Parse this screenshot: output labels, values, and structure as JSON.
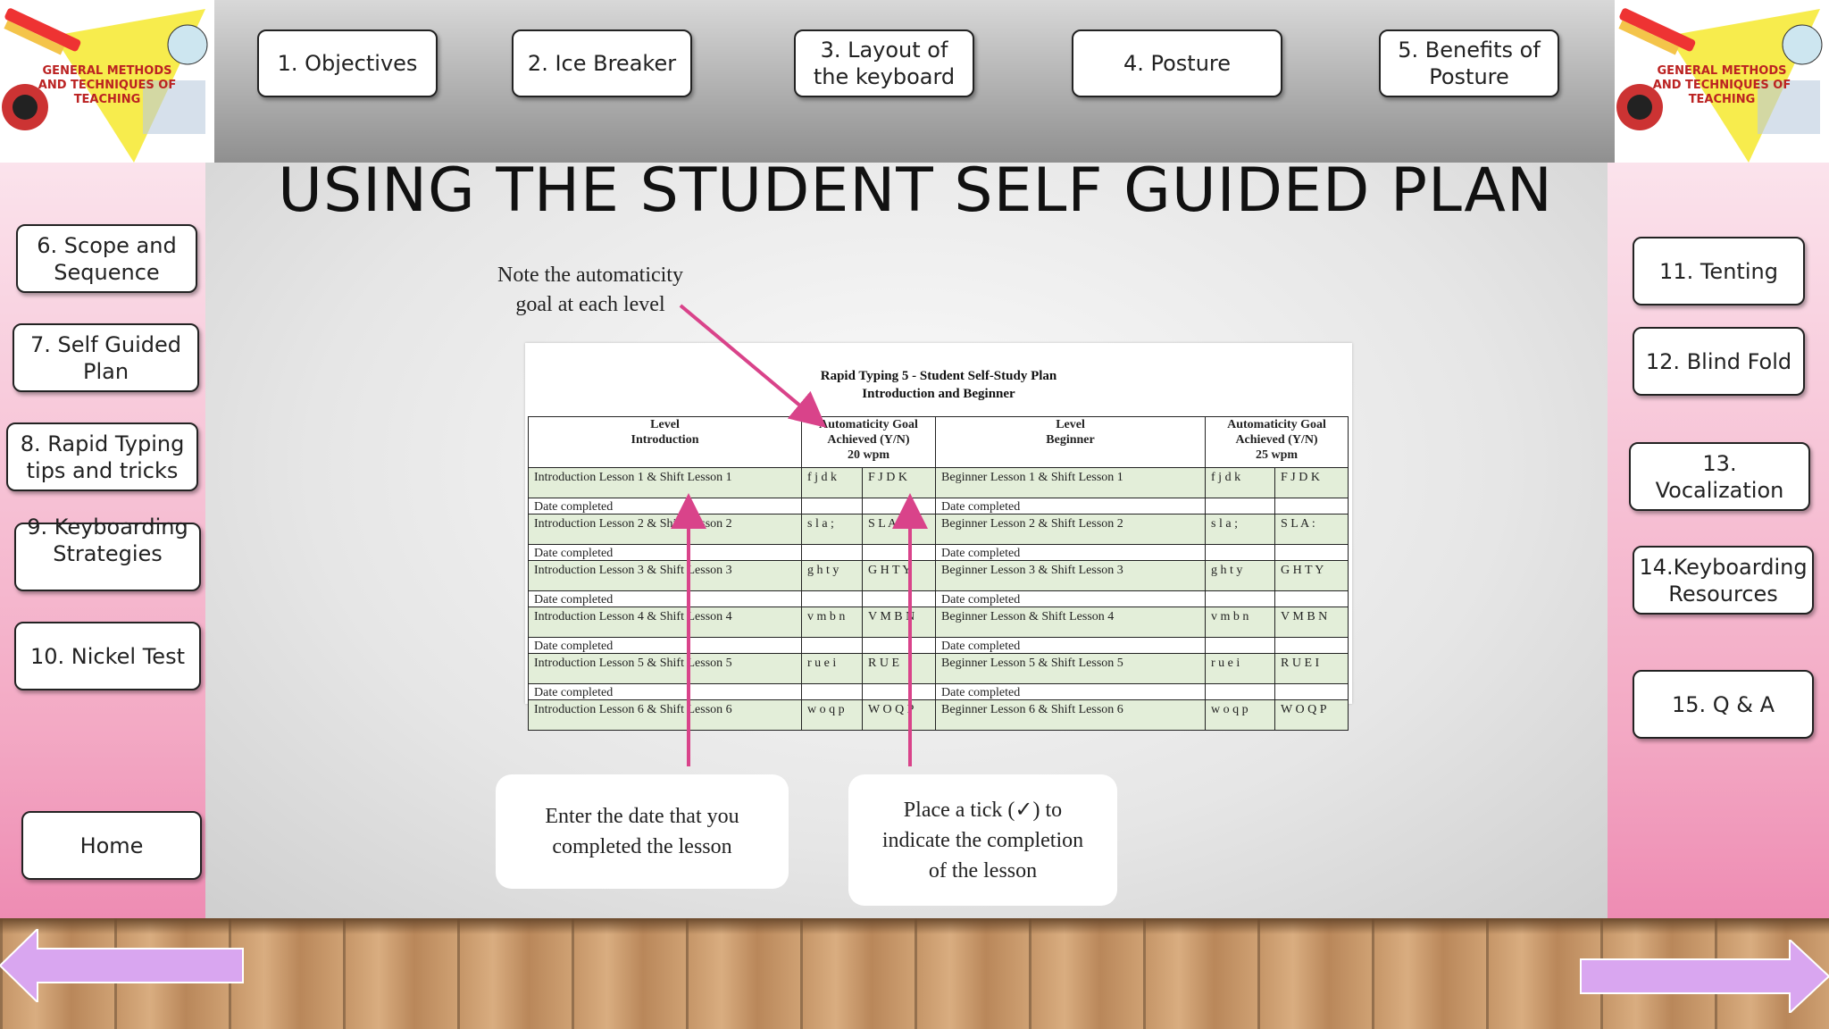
{
  "logo": {
    "text": "GENERAL METHODS AND TECHNIQUES OF TEACHING"
  },
  "top_nav": [
    "1. Objectives",
    "2. Ice Breaker",
    "3. Layout of the keyboard",
    "4. Posture",
    "5. Benefits of Posture"
  ],
  "left_nav": [
    "6. Scope and Sequence",
    "7. Self Guided Plan",
    "8. Rapid Typing tips and tricks",
    "9. Keyboarding Strategies",
    "10. Nickel Test",
    "Home"
  ],
  "right_nav": [
    "11. Tenting",
    "12. Blind Fold",
    "13. Vocalization",
    "14.Keyboarding Resources",
    "15. Q & A"
  ],
  "page_title": "USING THE STUDENT SELF GUIDED PLAN",
  "note_top": {
    "line1": "Note the automaticity",
    "line2": "goal at each level"
  },
  "document": {
    "title1": "Rapid Typing 5 - Student Self-Study Plan",
    "title2": "Introduction and Beginner",
    "headers": {
      "level_intro_1": "Level",
      "level_intro_2": "Introduction",
      "goal_intro_1": "Automaticity Goal",
      "goal_intro_2": "Achieved (Y/N)",
      "goal_intro_3": "20 wpm",
      "level_beg_1": "Level",
      "level_beg_2": "Beginner",
      "goal_beg_1": "Automaticity Goal",
      "goal_beg_2": "Achieved (Y/N)",
      "goal_beg_3": "25 wpm"
    },
    "date_label": "Date completed",
    "rows": [
      {
        "intro": "Introduction Lesson  1 & Shift Lesson  1",
        "lk1": "f j d k",
        "uk1": "F J D K",
        "beg": "Beginner Lesson  1 & Shift Lesson  1",
        "lk2": "f j d k",
        "uk2": "F J D K"
      },
      {
        "intro": "Introduction Lesson  2 & Shift Lesson 2",
        "lk1": "s l a ;",
        "uk1": "S L A :",
        "beg": "Beginner Lesson  2 & Shift Lesson 2",
        "lk2": "s l a ;",
        "uk2": "S L A :"
      },
      {
        "intro": "Introduction Lesson  3 & Shift Lesson  3",
        "lk1": "g h t y",
        "uk1": "G H T Y",
        "beg": "Beginner Lesson  3 &  Shift Lesson  3",
        "lk2": "g h t y",
        "uk2": "G H T Y"
      },
      {
        "intro": "Introduction Lesson  4 & Shift Lesson  4",
        "lk1": "v m b n",
        "uk1": "V M B N",
        "beg": "Beginner Lesson  & Shift Lesson  4",
        "lk2": "v m b n",
        "uk2": "V M B N"
      },
      {
        "intro": "Introduction Lesson  5 & Shift Lesson  5",
        "lk1": "r u e i",
        "uk1": "R U E",
        "beg": "Beginner Lesson  5 & Shift Lesson  5",
        "lk2": "r u e i",
        "uk2": "R U E I"
      },
      {
        "intro": "Introduction Lesson  6 & Shift Lesson  6",
        "lk1": "w o q p",
        "uk1": "W O Q P",
        "beg": "Beginner Lesson  6 & Shift Lesson  6",
        "lk2": "w o q p",
        "uk2": "W O Q P"
      }
    ]
  },
  "callouts": {
    "date": {
      "line1": "Enter the date that you",
      "line2": "completed the lesson"
    },
    "tick": {
      "line1": "Place a tick (✓) to",
      "line2": "indicate the completion",
      "line3": "of the lesson"
    }
  },
  "colors": {
    "arrow": "#d9438a",
    "nav_arrow": "#d9a6f0",
    "sidebar_pink": "#f3a9c4",
    "table_row": "#e3eed9"
  }
}
